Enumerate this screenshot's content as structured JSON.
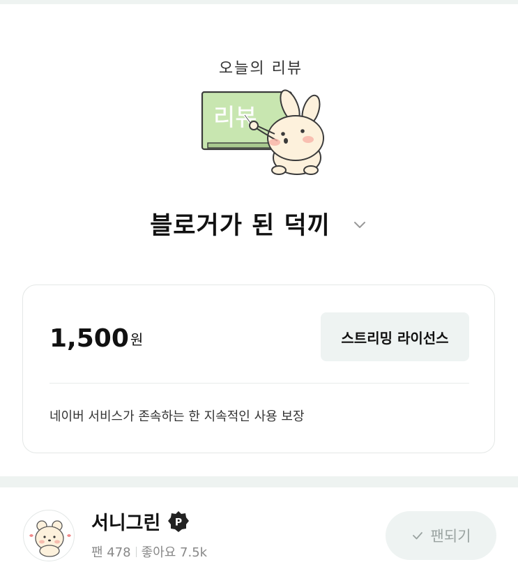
{
  "sticker": {
    "caption": "오늘의 리뷰",
    "board_text": "리뷰"
  },
  "post": {
    "title": "블로거가 된 덕끼"
  },
  "license_card": {
    "price": "1,500",
    "price_unit": "원",
    "button_label": "스트리밍 라이선스",
    "note": "네이버 서비스가 존속하는 한 지속적인 사용 보장"
  },
  "blogger": {
    "name": "서니그린",
    "badge_letter": "P",
    "fans_label": "팬 478",
    "likes_label": "좋아요 7.5k",
    "fan_button_label": "팬되기"
  },
  "colors": {
    "band": "#eef3f1",
    "button_bg": "#eef3f2",
    "board_green": "#c8e6b0",
    "badge_dark": "#222222"
  },
  "icons": [
    "chevron-down-icon",
    "power-badge-icon",
    "checkmark-icon"
  ]
}
